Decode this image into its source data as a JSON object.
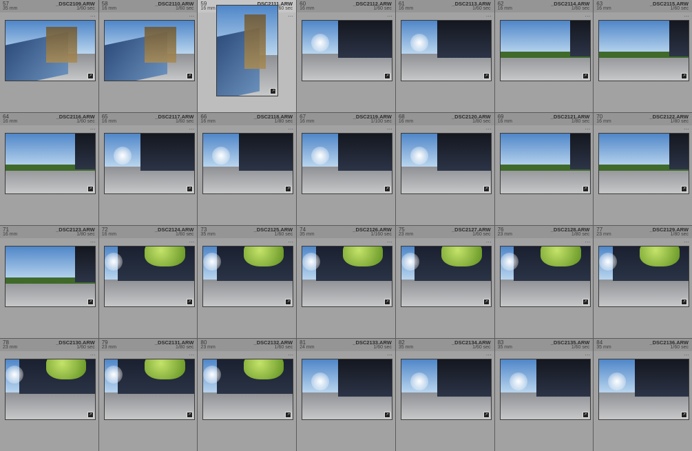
{
  "cells": [
    {
      "index": "57",
      "filename": "_DSC2109.ARW",
      "focal": "35 mm",
      "shutter": "1/60 sec",
      "orientation": "land",
      "scene": "glass"
    },
    {
      "index": "58",
      "filename": "_DSC2110.ARW",
      "focal": "16 mm",
      "shutter": "1/60 sec",
      "orientation": "land",
      "scene": "glass"
    },
    {
      "index": "59",
      "filename": "_DSC2111.ARW",
      "focal": "16 mm",
      "shutter": "1/60 sec",
      "orientation": "port",
      "scene": "glass",
      "selected": true
    },
    {
      "index": "60",
      "filename": "_DSC2112.ARW",
      "focal": "16 mm",
      "shutter": "1/60 sec",
      "orientation": "land",
      "scene": "plaza"
    },
    {
      "index": "61",
      "filename": "_DSC2113.ARW",
      "focal": "16 mm",
      "shutter": "1/60 sec",
      "orientation": "land",
      "scene": "plaza"
    },
    {
      "index": "62",
      "filename": "_DSC2114.ARW",
      "focal": "16 mm",
      "shutter": "1/60 sec",
      "orientation": "land",
      "scene": "field"
    },
    {
      "index": "63",
      "filename": "_DSC2115.ARW",
      "focal": "16 mm",
      "shutter": "1/60 sec",
      "orientation": "land",
      "scene": "field"
    },
    {
      "index": "64",
      "filename": "_DSC2116.ARW",
      "focal": "16 mm",
      "shutter": "1/60 sec",
      "orientation": "land",
      "scene": "field"
    },
    {
      "index": "65",
      "filename": "_DSC2117.ARW",
      "focal": "16 mm",
      "shutter": "1/60 sec",
      "orientation": "land",
      "scene": "plaza"
    },
    {
      "index": "66",
      "filename": "_DSC2118.ARW",
      "focal": "16 mm",
      "shutter": "1/80 sec",
      "orientation": "land",
      "scene": "plaza"
    },
    {
      "index": "67",
      "filename": "_DSC2119.ARW",
      "focal": "16 mm",
      "shutter": "1/100 sec",
      "orientation": "land",
      "scene": "plaza"
    },
    {
      "index": "68",
      "filename": "_DSC2120.ARW",
      "focal": "16 mm",
      "shutter": "1/80 sec",
      "orientation": "land",
      "scene": "plaza"
    },
    {
      "index": "69",
      "filename": "_DSC2121.ARW",
      "focal": "16 mm",
      "shutter": "1/80 sec",
      "orientation": "land",
      "scene": "field"
    },
    {
      "index": "70",
      "filename": "_DSC2122.ARW",
      "focal": "16 mm",
      "shutter": "1/80 sec",
      "orientation": "land",
      "scene": "field"
    },
    {
      "index": "71",
      "filename": "_DSC2123.ARW",
      "focal": "16 mm",
      "shutter": "1/80 sec",
      "orientation": "land",
      "scene": "field"
    },
    {
      "index": "72",
      "filename": "_DSC2124.ARW",
      "focal": "16 mm",
      "shutter": "1/60 sec",
      "orientation": "land",
      "scene": "leaves"
    },
    {
      "index": "73",
      "filename": "_DSC2125.ARW",
      "focal": "35 mm",
      "shutter": "1/60 sec",
      "orientation": "land",
      "scene": "leaves"
    },
    {
      "index": "74",
      "filename": "_DSC2126.ARW",
      "focal": "35 mm",
      "shutter": "1/160 sec",
      "orientation": "land",
      "scene": "leaves"
    },
    {
      "index": "75",
      "filename": "_DSC2127.ARW",
      "focal": "23 mm",
      "shutter": "1/60 sec",
      "orientation": "land",
      "scene": "leaves"
    },
    {
      "index": "76",
      "filename": "_DSC2128.ARW",
      "focal": "23 mm",
      "shutter": "1/80 sec",
      "orientation": "land",
      "scene": "leaves"
    },
    {
      "index": "77",
      "filename": "_DSC2129.ARW",
      "focal": "23 mm",
      "shutter": "1/80 sec",
      "orientation": "land",
      "scene": "leaves"
    },
    {
      "index": "78",
      "filename": "_DSC2130.ARW",
      "focal": "23 mm",
      "shutter": "1/60 sec",
      "orientation": "land",
      "scene": "leaves"
    },
    {
      "index": "79",
      "filename": "_DSC2131.ARW",
      "focal": "23 mm",
      "shutter": "1/80 sec",
      "orientation": "land",
      "scene": "leaves"
    },
    {
      "index": "80",
      "filename": "_DSC2132.ARW",
      "focal": "23 mm",
      "shutter": "1/60 sec",
      "orientation": "land",
      "scene": "leaves"
    },
    {
      "index": "81",
      "filename": "_DSC2133.ARW",
      "focal": "24 mm",
      "shutter": "1/60 sec",
      "orientation": "land",
      "scene": "plaza"
    },
    {
      "index": "82",
      "filename": "_DSC2134.ARW",
      "focal": "35 mm",
      "shutter": "1/60 sec",
      "orientation": "land",
      "scene": "plaza"
    },
    {
      "index": "83",
      "filename": "_DSC2135.ARW",
      "focal": "35 mm",
      "shutter": "1/60 sec",
      "orientation": "land",
      "scene": "plaza"
    },
    {
      "index": "84",
      "filename": "_DSC2136.ARW",
      "focal": "35 mm",
      "shutter": "1/60 sec",
      "orientation": "land",
      "scene": "plaza"
    }
  ],
  "colors": {
    "cell_bg": "#a2a2a2",
    "selected_bg": "#bdbdbd",
    "grid_line": "#5a5a5a"
  }
}
